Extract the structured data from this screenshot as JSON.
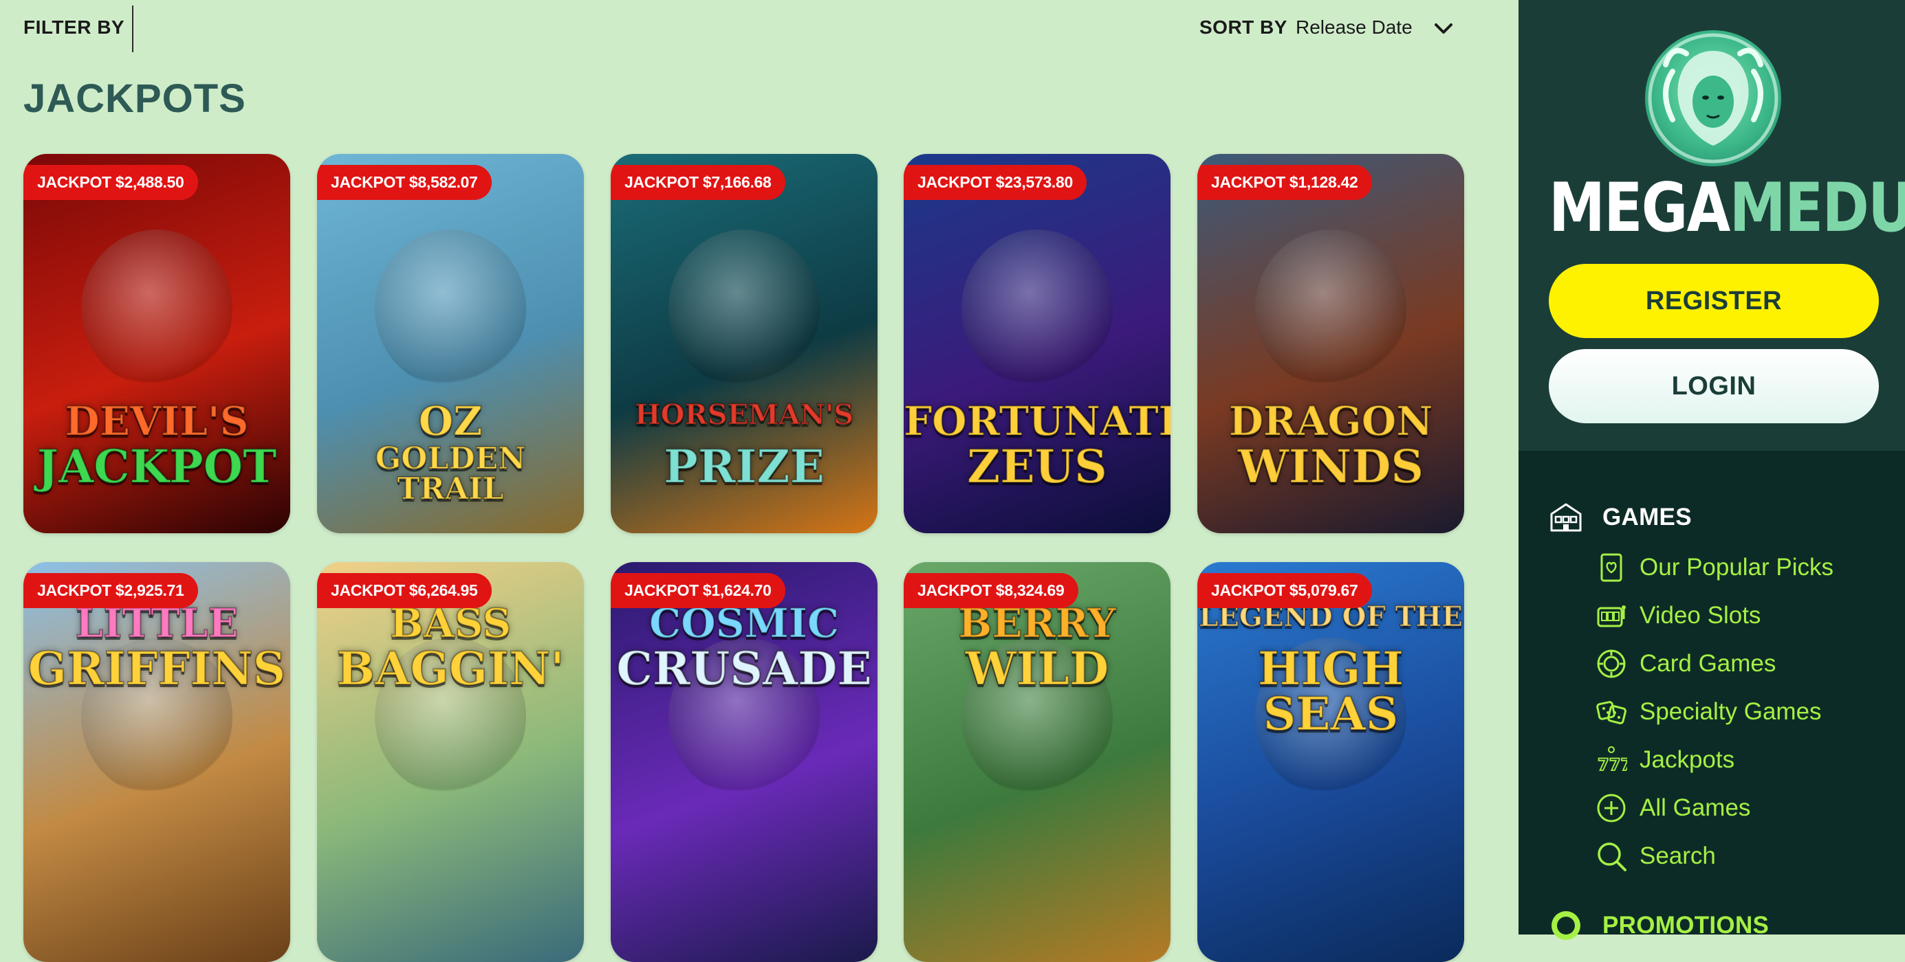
{
  "toolbar": {
    "filter_label": "FILTER BY",
    "sort_label": "SORT BY",
    "sort_value": "Release Date"
  },
  "page": {
    "title": "JACKPOTS"
  },
  "games": [
    {
      "jackpot": "JACKPOT $2,488.50",
      "line1": "DEVIL'S",
      "line2": "JACKPOT",
      "colors": [
        "#7a0808",
        "#c81e0e",
        "#2a0303"
      ],
      "c1": "#ff6a2a",
      "c2": "#3dd84f"
    },
    {
      "jackpot": "JACKPOT $8,582.07",
      "line1": "OZ",
      "line2": "GOLDEN TRAIL",
      "colors": [
        "#6fb6d6",
        "#4d8fb0",
        "#8a6a2a"
      ],
      "c1": "#ffd84a",
      "c2": "#ffd84a"
    },
    {
      "jackpot": "JACKPOT $7,166.68",
      "line1": "HORSEMAN'S",
      "line2": "PRIZE",
      "colors": [
        "#1a6c78",
        "#0e3b44",
        "#d67515"
      ],
      "c1": "#e23b2b",
      "c2": "#7ee0d2"
    },
    {
      "jackpot": "JACKPOT $23,573.80",
      "line1": "FORTUNATE",
      "line2": "ZEUS",
      "colors": [
        "#1b3a8a",
        "#3b1a7a",
        "#0b0e38"
      ],
      "c1": "#ffcf3a",
      "c2": "#ffcf3a"
    },
    {
      "jackpot": "JACKPOT $1,128.42",
      "line1": "DRAGON",
      "line2": "WINDS",
      "colors": [
        "#3c5a7a",
        "#7a3a22",
        "#1a1a2e"
      ],
      "c1": "#ffcc3a",
      "c2": "#ffcc3a"
    },
    {
      "jackpot": "JACKPOT $2,925.71",
      "line1": "LITTLE",
      "line2": "GRIFFINS",
      "colors": [
        "#8cc0e8",
        "#c28a44",
        "#6a4018"
      ],
      "c1": "#ff7ac0",
      "c2": "#ffd23a"
    },
    {
      "jackpot": "JACKPOT $6,264.95",
      "line1": "BASS",
      "line2": "BAGGIN'",
      "colors": [
        "#f2d088",
        "#8ab87a",
        "#3a6a7a"
      ],
      "c1": "#ffd23a",
      "c2": "#ffd23a"
    },
    {
      "jackpot": "JACKPOT $1,624.70",
      "line1": "COSMIC",
      "line2": "CRUSADE",
      "colors": [
        "#2a1a6e",
        "#6a2ab8",
        "#1a1a4a"
      ],
      "c1": "#7ad8ff",
      "c2": "#e0f4ff"
    },
    {
      "jackpot": "JACKPOT $8,324.69",
      "line1": "BERRY",
      "line2": "WILD",
      "colors": [
        "#6aa86a",
        "#3d7a3d",
        "#b57a24"
      ],
      "c1": "#ffb02a",
      "c2": "#ffd23a"
    },
    {
      "jackpot": "JACKPOT $5,079.67",
      "line1": "LEGEND OF THE",
      "line2": "HIGH SEAS",
      "colors": [
        "#2a7ad0",
        "#1a4a9a",
        "#0a2a5a"
      ],
      "c1": "#ffd87a",
      "c2": "#ffd23a"
    }
  ],
  "brand": {
    "mega": "MEGA",
    "medusa": "MEDUSA"
  },
  "auth": {
    "register": "REGISTER",
    "login": "LOGIN"
  },
  "nav": {
    "games_label": "GAMES",
    "items": [
      {
        "label": "Our Popular Picks",
        "icon": "heart-card-icon"
      },
      {
        "label": "Video Slots",
        "icon": "slot-machine-icon"
      },
      {
        "label": "Card Games",
        "icon": "poker-chip-icon"
      },
      {
        "label": "Specialty Games",
        "icon": "dice-icon"
      },
      {
        "label": "Jackpots",
        "icon": "jackpot-777-icon"
      },
      {
        "label": "All Games",
        "icon": "plus-circle-icon"
      },
      {
        "label": "Search",
        "icon": "search-icon"
      }
    ],
    "promotions_label": "PROMOTIONS"
  },
  "theme": {
    "accent_green": "#a5f045",
    "badge_red": "#e11414",
    "register_yellow": "#fff200",
    "sidebar_dark": "#0d2b26",
    "sidebar_top": "#1b3d38",
    "page_bg": "#cfecc9",
    "title_color": "#2e5a55"
  }
}
